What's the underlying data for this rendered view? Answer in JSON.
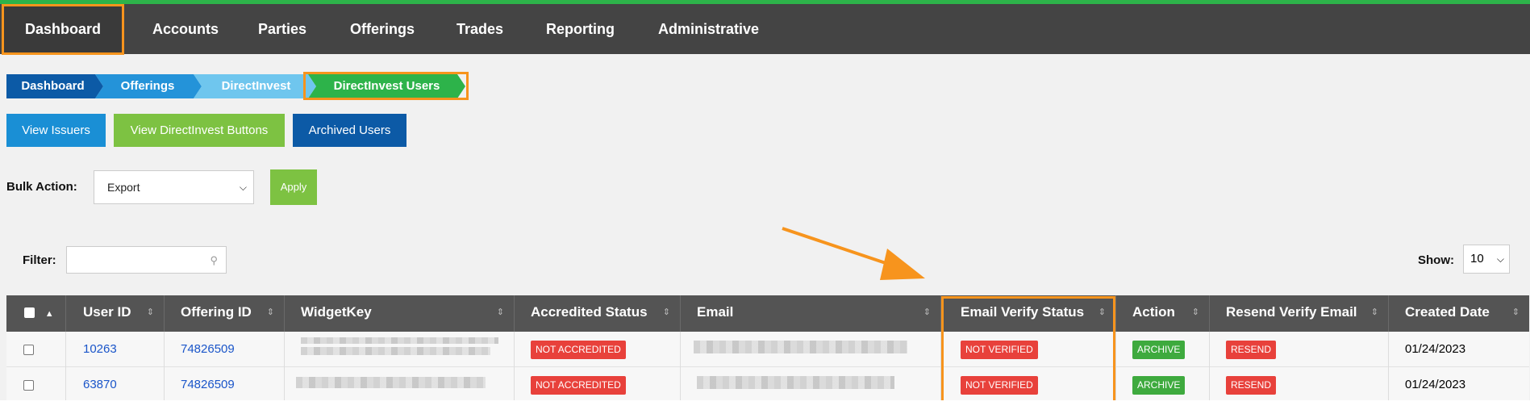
{
  "nav": {
    "items": [
      "Dashboard",
      "Accounts",
      "Parties",
      "Offerings",
      "Trades",
      "Reporting",
      "Administrative"
    ],
    "active": "Dashboard"
  },
  "breadcrumb": [
    "Dashboard",
    "Offerings",
    "DirectInvest",
    "DirectInvest Users"
  ],
  "buttons": {
    "view_issuers": "View Issuers",
    "view_directinvest_buttons": "View DirectInvest Buttons",
    "archived_users": "Archived Users"
  },
  "bulk": {
    "label": "Bulk Action:",
    "selected": "Export",
    "apply": "Apply"
  },
  "filter": {
    "label": "Filter:",
    "value": ""
  },
  "show": {
    "label": "Show:",
    "value": "10"
  },
  "table": {
    "headers": [
      "User ID",
      "Offering ID",
      "WidgetKey",
      "Accredited Status",
      "Email",
      "Email Verify Status",
      "Action",
      "Resend Verify Email",
      "Created Date"
    ],
    "rows": [
      {
        "user_id": "10263",
        "offering_id": "74826509",
        "accredited": "NOT ACCREDITED",
        "verify": "NOT VERIFIED",
        "action": "ARCHIVE",
        "resend": "RESEND",
        "created": "01/24/2023"
      },
      {
        "user_id": "63870",
        "offering_id": "74826509",
        "accredited": "NOT ACCREDITED",
        "verify": "NOT VERIFIED",
        "action": "ARCHIVE",
        "resend": "RESEND",
        "created": "01/24/2023"
      }
    ]
  },
  "colors": {
    "accent_orange": "#f7941d",
    "topbar": "#444444",
    "topbar_border": "#2db34a",
    "badge_red": "#e8413b",
    "badge_green": "#3eaa3e",
    "crumb1": "#0c5aa6",
    "crumb2": "#2493d9",
    "crumb3": "#6fc6ee",
    "crumb4": "#2db34a"
  }
}
